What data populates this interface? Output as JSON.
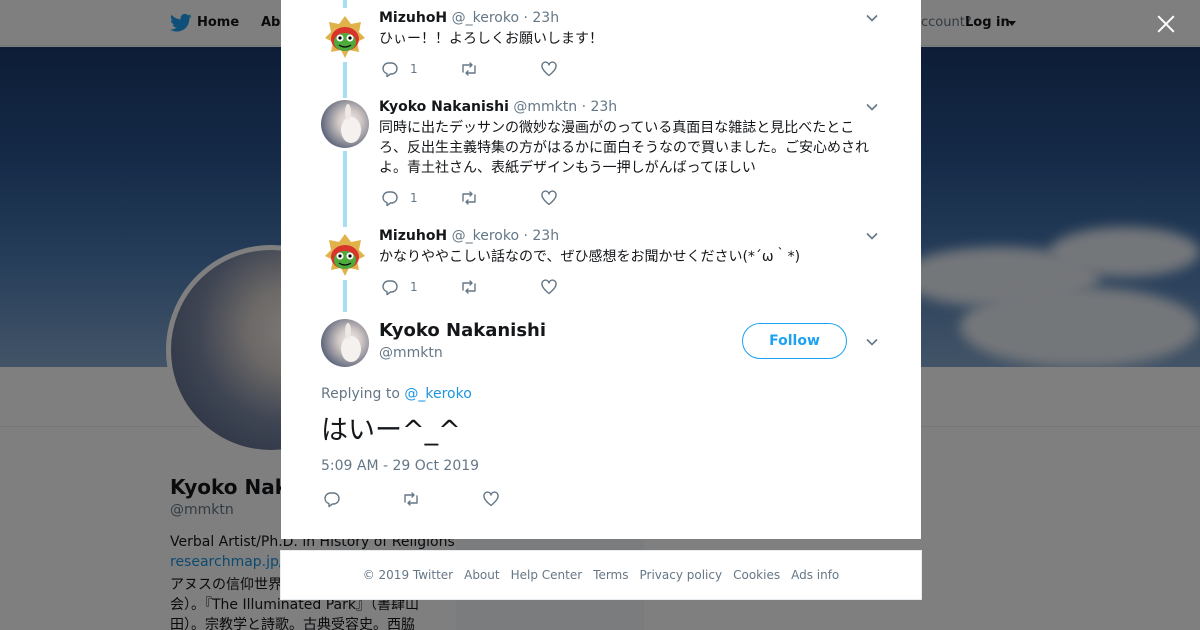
{
  "topbar": {
    "home_label": "Home",
    "about_label": "Abo",
    "account_text": "ccount?",
    "login_label": "Log in"
  },
  "profile": {
    "name": "Kyoko Nak",
    "handle": "@mmktn",
    "bio_line1": "Verbal Artist/Ph.D. in History of Religions",
    "bio_line2": "researchmap.jp/k",
    "bio_line3": "アヌスの信仰世界",
    "bio_line4": "会）。『The Illuminated Park』（書肆山",
    "bio_line5": "田）。宗教学と詩歌。古典受容史。西脇"
  },
  "thread": {
    "replies": [
      {
        "name": "MizuhoH",
        "handle": "@_keroko",
        "time": "· 23h",
        "text": "ひぃー！！よろしくお願いします！",
        "reply_count": "1",
        "avatar": "kero-frog"
      },
      {
        "name": "Kyoko Nakanishi",
        "handle": "@mmktn",
        "time": "· 23h",
        "text": "同時に出たデッサンの微妙な漫画がのっている真面目な雑誌と見比べたところ、反出生主義特集の方がはるかに面白そうなので買いました。ご安心めされよ。青土社さん、表紙デザインもう一押しがんばってほしい",
        "reply_count": "1",
        "avatar": "white-rabbit"
      },
      {
        "name": "MizuhoH",
        "handle": "@_keroko",
        "time": "· 23h",
        "text": "かなりややこしい話なので、ぜひ感想をお聞かせください(*´ω｀*)",
        "reply_count": "1",
        "avatar": "kero-frog"
      }
    ],
    "main": {
      "name": "Kyoko Nakanishi",
      "handle": "@mmktn",
      "follow_label": "Follow",
      "replying_prefix": "Replying to",
      "replying_to": "@_keroko",
      "text": "はいー^_^",
      "timestamp": "5:09 AM - 29 Oct 2019"
    }
  },
  "footer": {
    "links": [
      "© 2019 Twitter",
      "About",
      "Help Center",
      "Terms",
      "Privacy policy",
      "Cookies",
      "Ads info"
    ]
  },
  "colors": {
    "twitter_blue": "#1da1f2",
    "thread_line": "#a6def4",
    "muted_text": "#657786",
    "overlay": "rgba(0,0,0,0.5)"
  },
  "icons": [
    "twitter-bird-icon",
    "close-icon",
    "reply-icon",
    "retweet-icon",
    "like-icon",
    "chevron-down-icon"
  ]
}
